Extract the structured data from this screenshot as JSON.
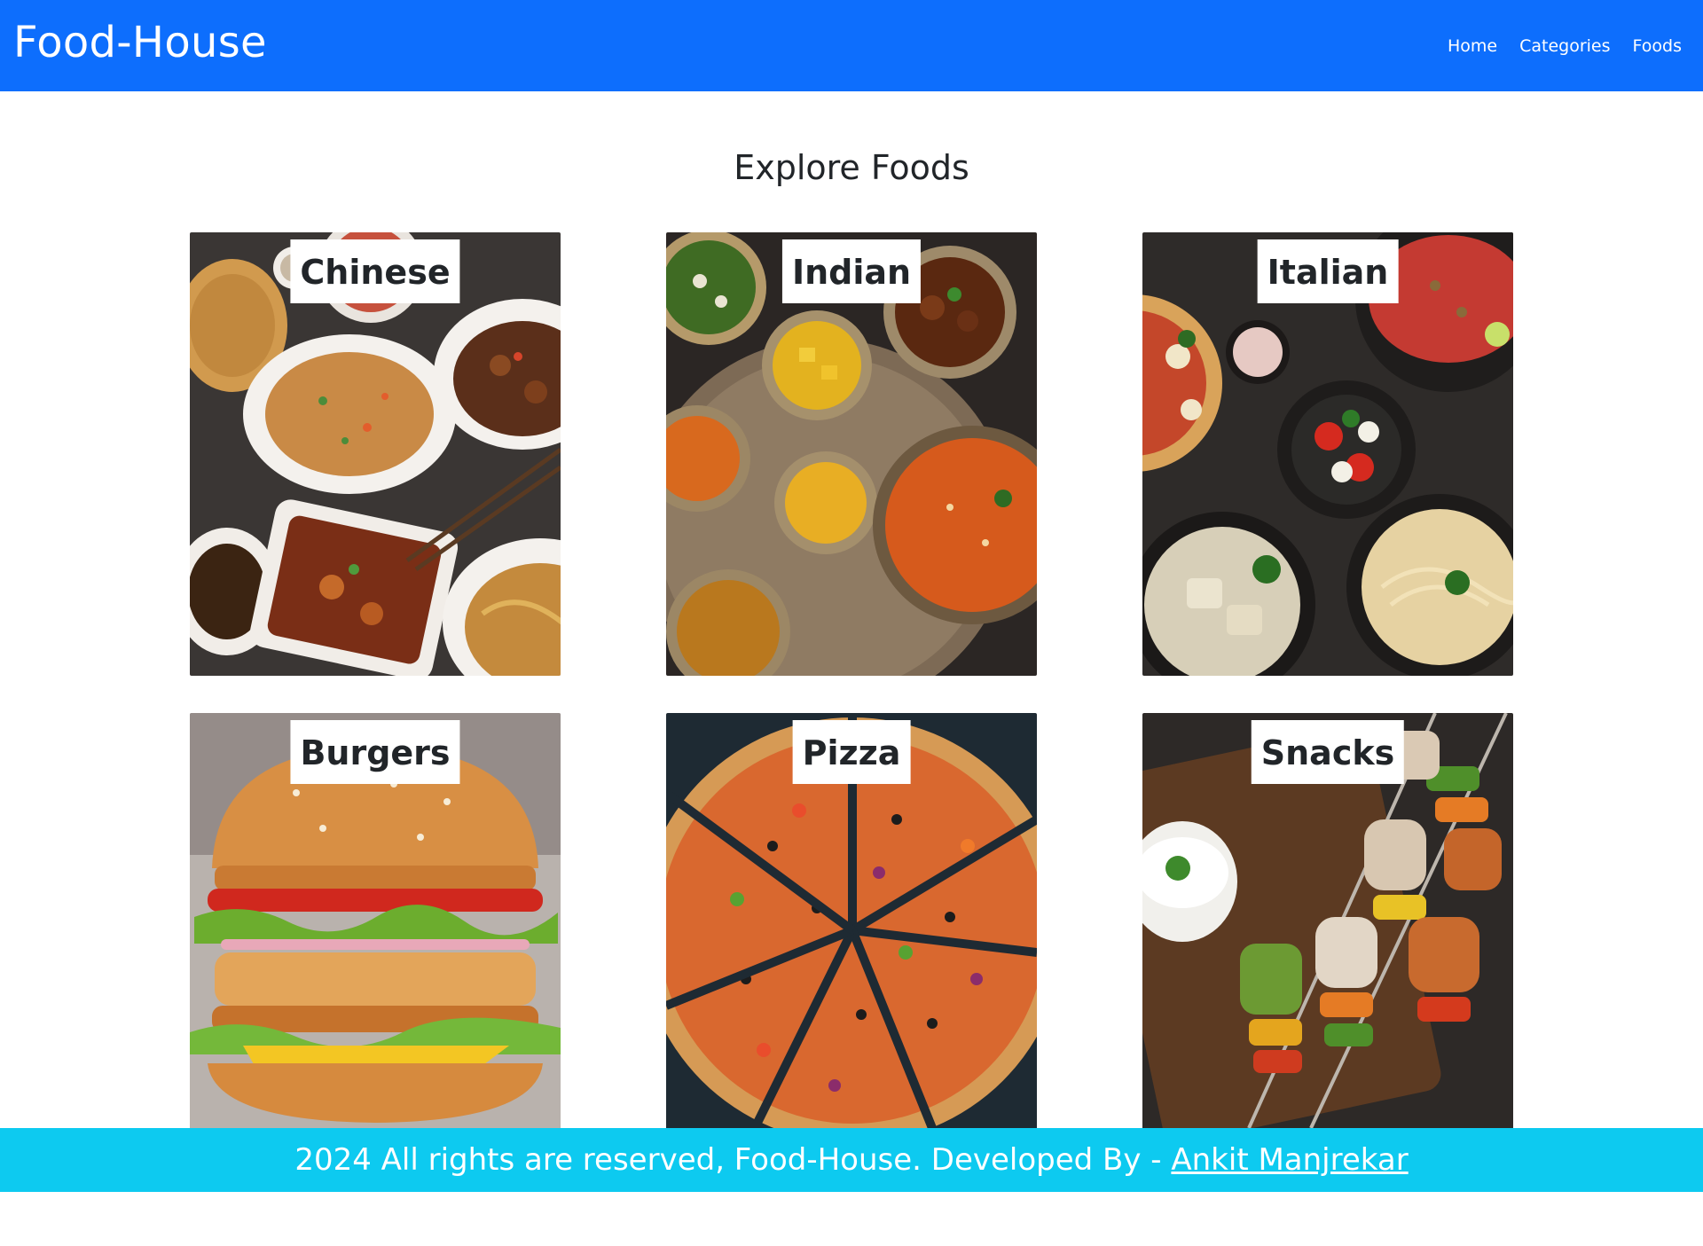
{
  "navbar": {
    "brand": "Food-House",
    "links": [
      "Home",
      "Categories",
      "Foods"
    ]
  },
  "main": {
    "title": "Explore Foods",
    "categories": [
      {
        "label": "Chinese",
        "image_icon": "chinese-food-photo"
      },
      {
        "label": "Indian",
        "image_icon": "indian-food-photo"
      },
      {
        "label": "Italian",
        "image_icon": "italian-food-photo"
      },
      {
        "label": "Burgers",
        "image_icon": "burger-photo"
      },
      {
        "label": "Pizza",
        "image_icon": "pizza-photo"
      },
      {
        "label": "Snacks",
        "image_icon": "snacks-photo"
      }
    ]
  },
  "footer": {
    "text": "2024 All rights are reserved, Food-House. Developed By - ",
    "author": "Ankit Manjrekar"
  },
  "colors": {
    "navbar_bg": "#0d6efd",
    "footer_bg": "#0dcaf0",
    "text": "#212529"
  }
}
